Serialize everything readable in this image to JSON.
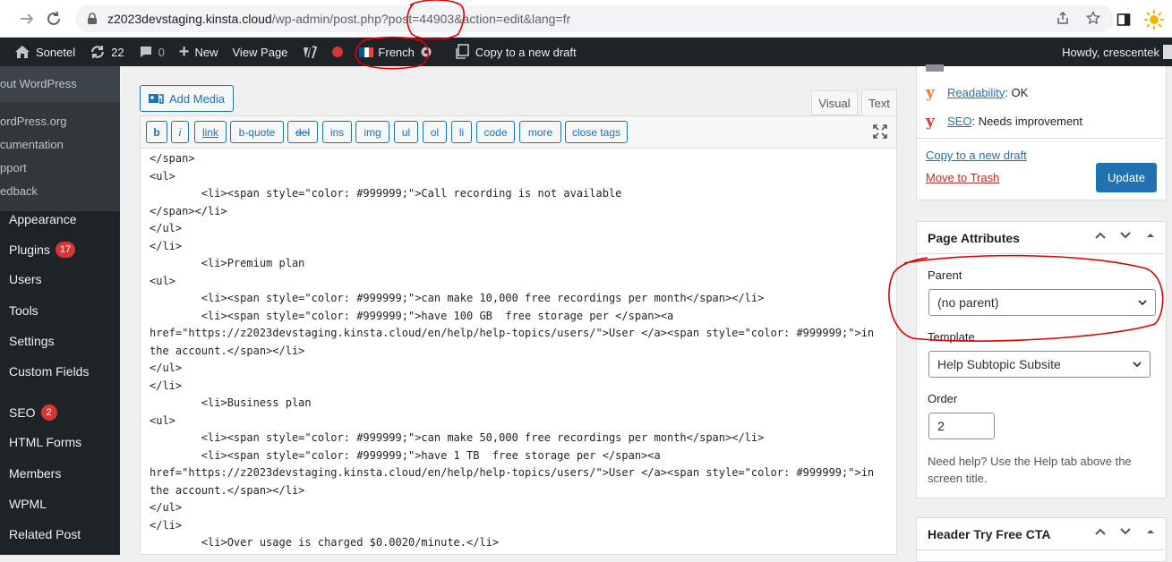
{
  "browser": {
    "url_host": "z2023devstaging.kinsta.cloud",
    "url_path": "/wp-admin/post.php?post=44903&action=edit&lang=fr"
  },
  "adminbar": {
    "site_name": "Sonetel",
    "updates_count": "22",
    "comments_count": "0",
    "new_label": "New",
    "view_page_label": "View Page",
    "language_label": "French",
    "copy_draft_label": "Copy to a new draft",
    "howdy_label": "Howdy, crescentek"
  },
  "about_flyout": {
    "title": "out WordPress",
    "items": [
      "ordPress.org",
      "cumentation",
      "pport",
      "edback"
    ]
  },
  "menu": {
    "appearance": "Appearance",
    "plugins": "Plugins",
    "plugins_badge": "17",
    "users": "Users",
    "tools": "Tools",
    "settings": "Settings",
    "custom_fields": "Custom Fields",
    "seo": "SEO",
    "seo_badge": "2",
    "html_forms": "HTML Forms",
    "members": "Members",
    "wpml": "WPML",
    "related_post": "Related Post"
  },
  "editor": {
    "add_media_label": "Add Media",
    "tab_visual": "Visual",
    "tab_text": "Text",
    "quicktags": [
      "b",
      "i",
      "link",
      "b-quote",
      "del",
      "ins",
      "img",
      "ul",
      "ol",
      "li",
      "code",
      "more",
      "close tags"
    ],
    "code_lines": [
      "</span>",
      "<ul>",
      "        <li><span style=\"color: #999999;\">Call recording is not available",
      "</span></li>",
      "</ul>",
      "</li>",
      "        <li>Premium plan",
      "<ul>",
      "        <li><span style=\"color: #999999;\">can make 10,000 free recordings per month</span></li>",
      "        <li><span style=\"color: #999999;\">have 100 GB  free storage per </span><a",
      "href=\"https://z2023devstaging.kinsta.cloud/en/help/help-topics/users/\">User </a><span style=\"color: #999999;\">in",
      "the account.</span></li>",
      "</ul>",
      "</li>",
      "        <li>Business plan",
      "<ul>",
      "        <li><span style=\"color: #999999;\">can make 50,000 free recordings per month</span></li>",
      "        <li><span style=\"color: #999999;\">have 1 TB  free storage per </span><a",
      "href=\"https://z2023devstaging.kinsta.cloud/en/help/help-topics/users/\">User </a><span style=\"color: #999999;\">in",
      "the account.</span></li>",
      "</ul>",
      "</li>",
      "        <li>Over usage is charged $0.0020/minute.</li>"
    ]
  },
  "publish": {
    "readability_label": "Readability",
    "readability_value": ": OK",
    "seo_label": "SEO",
    "seo_value": ": Needs improvement",
    "copy_draft_link": "Copy to a new draft",
    "trash_link": "Move to Trash",
    "update_label": "Update"
  },
  "page_attributes": {
    "title": "Page Attributes",
    "parent_label": "Parent",
    "parent_value": "(no parent)",
    "template_label": "Template",
    "template_value": "Help Subtopic Subsite",
    "order_label": "Order",
    "order_value": "2",
    "help_text": "Need help? Use the Help tab above the screen title."
  },
  "header_cta": {
    "title": "Header Try Free CTA"
  },
  "colors": {
    "admin_dark": "#1d2327",
    "wp_blue": "#2271b1",
    "badge_red": "#d63638",
    "annotation_red": "#e00000"
  }
}
